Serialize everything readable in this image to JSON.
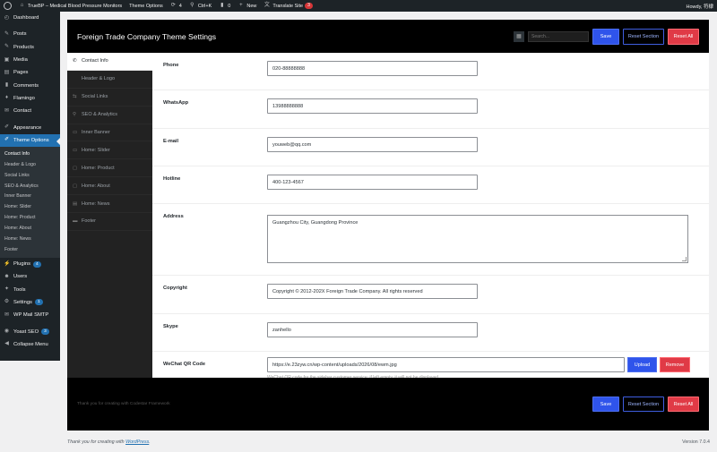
{
  "adminbar": {
    "site_name": "TrueBP – Medical Blood Pressure Monitors",
    "theme_options": "Theme Options",
    "updates_count": "4",
    "shortcut": "Ctrl+K",
    "comments_count": "0",
    "new_label": "New",
    "translate_label": "Translate Site",
    "translate_badge": "3",
    "howdy": "Howdy, 符棣"
  },
  "menu": {
    "dashboard": "Dashboard",
    "posts": "Posts",
    "products": "Products",
    "media": "Media",
    "pages": "Pages",
    "comments": "Comments",
    "flamingo": "Flamingo",
    "contact": "Contact",
    "appearance": "Appearance",
    "theme_options": "Theme Options",
    "submenu": [
      "Contact Info",
      "Header & Logo",
      "Social Links",
      "SEO & Analytics",
      "Inner Banner",
      "Home: Slider",
      "Home: Product",
      "Home: About",
      "Home: News",
      "Footer"
    ],
    "plugins": "Plugins",
    "plugins_count": "4",
    "users": "Users",
    "tools": "Tools",
    "settings": "Settings",
    "settings_count": "1",
    "wp_mail": "WP Mail SMTP",
    "yoast": "Yoast SEO",
    "yoast_count": "3",
    "collapse": "Collapse Menu"
  },
  "panel": {
    "title": "Foreign Trade Company Theme Settings",
    "search_placeholder": "Search...",
    "save": "Save",
    "reset_section": "Reset Section",
    "reset_all": "Reset All",
    "nav": [
      "Contact Info",
      "Header & Logo",
      "Social Links",
      "SEO & Analytics",
      "Inner Banner",
      "Home: Slider",
      "Home: Product",
      "Home: About",
      "Home: News",
      "Footer"
    ],
    "fields": {
      "phone": {
        "label": "Phone",
        "value": "020-88888888"
      },
      "whatsapp": {
        "label": "WhatsApp",
        "value": "13988888888"
      },
      "email": {
        "label": "E-mail",
        "value": "youweb@qq.com"
      },
      "hotline": {
        "label": "Hotline",
        "value": "400-123-4567"
      },
      "address": {
        "label": "Address",
        "value": "Guangzhou City, Guangdong Province"
      },
      "copyright": {
        "label": "Copyright",
        "value": "Copyright © 2012-202X Foreign Trade Company. All rights reserved"
      },
      "skype": {
        "label": "Skype",
        "value": "zanhello"
      },
      "wechat": {
        "label": "WeChat QR Code",
        "value": "https://e.23zyw.cn/wp-content/uploads/2026/08/ewm.jpg",
        "upload": "Upload",
        "remove": "Remove",
        "desc": "WeChat QR code for the sidebar customer service; if left empty, it will not be displayed"
      }
    },
    "footer_note": "Thank you for creating with Codestar Framework"
  },
  "wpfooter": {
    "thanks_prefix": "Thank you for creating with ",
    "wordpress": "WordPress",
    "thanks_suffix": ".",
    "version": "Version 7.0.4"
  }
}
